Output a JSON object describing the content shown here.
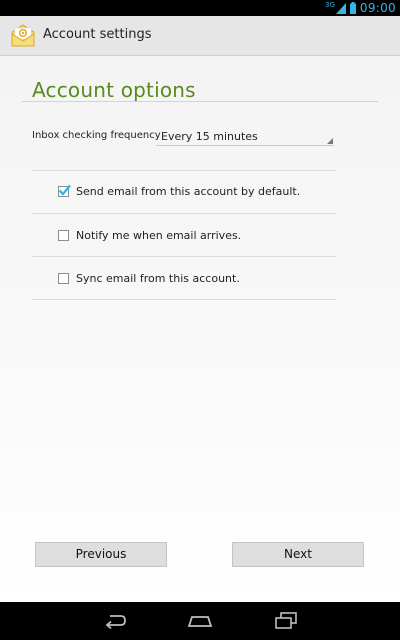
{
  "status_bar": {
    "network": "3G",
    "time": "09:00",
    "accent": "#33b5e5",
    "icons": [
      "signal-icon",
      "battery-icon"
    ]
  },
  "action_bar": {
    "title": "Account settings",
    "app_icon": "email-app-icon"
  },
  "account_options": {
    "title": "Account options",
    "frequency_label": "Inbox checking frequency",
    "frequency_value": "Every 15 minutes",
    "options": [
      {
        "label": "Send email from this account by default.",
        "checked": true
      },
      {
        "label": "Notify me when email arrives.",
        "checked": false
      },
      {
        "label": "Sync email from this account.",
        "checked": false
      }
    ]
  },
  "buttons": {
    "previous": "Previous",
    "next": "Next"
  },
  "nav_bar": {
    "icons": [
      "back-icon",
      "home-icon",
      "recent-apps-icon"
    ]
  }
}
